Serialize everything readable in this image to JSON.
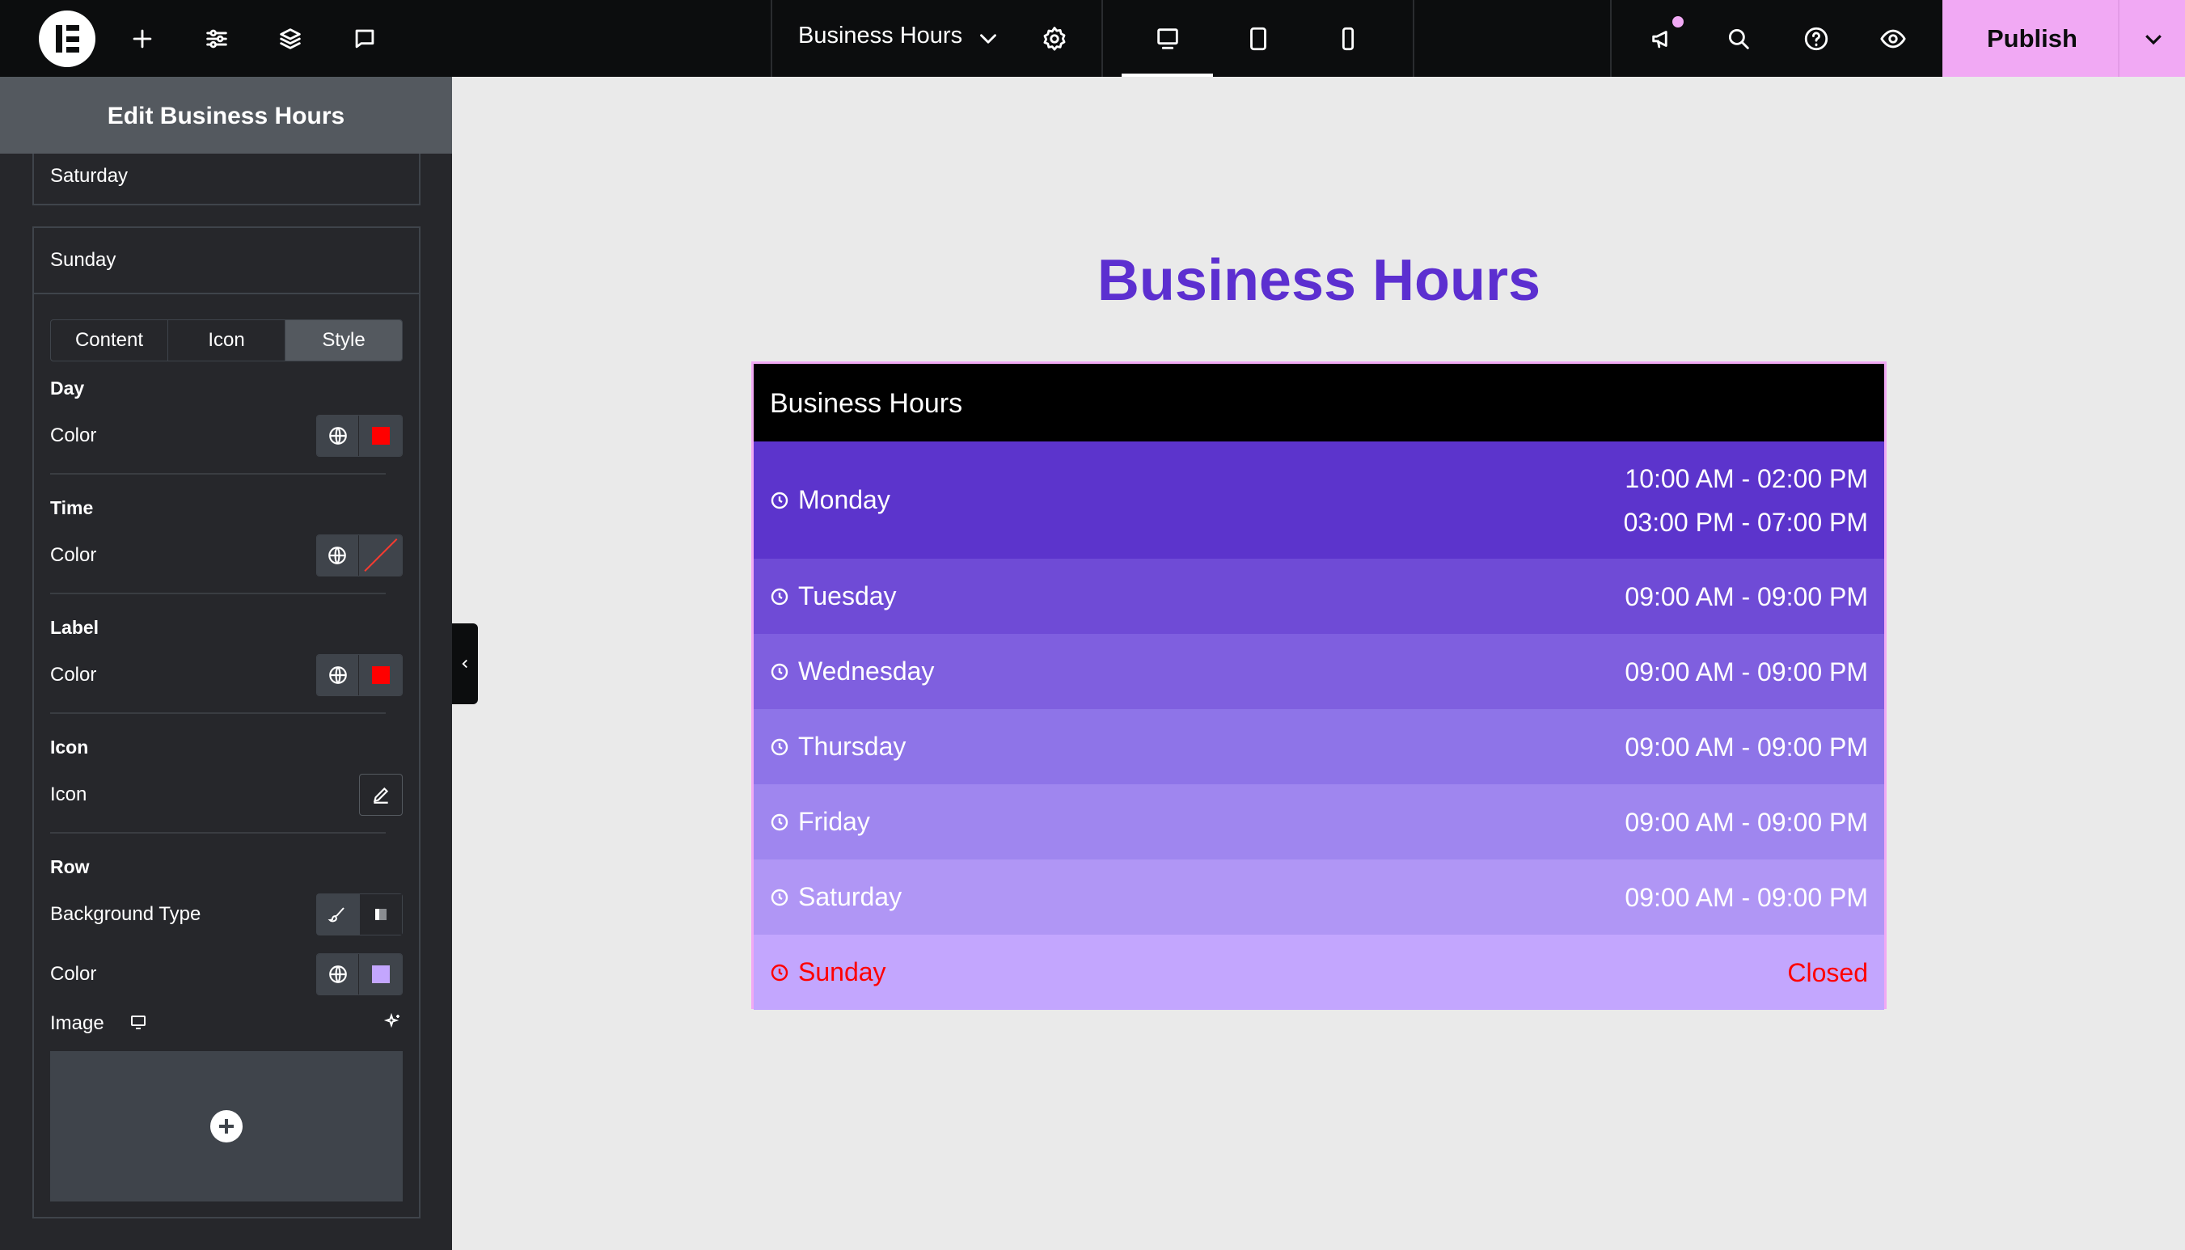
{
  "topbar": {
    "document_title": "Business Hours",
    "publish_label": "Publish",
    "colors": {
      "background": "#0c0d0e",
      "publish": "#f1a9f4",
      "notification_dot": "#f1a9f4"
    }
  },
  "panel": {
    "title": "Edit Business Hours",
    "repeater_items": [
      "Saturday",
      "Sunday"
    ],
    "tabs": [
      {
        "label": "Content",
        "active": false
      },
      {
        "label": "Icon",
        "active": false
      },
      {
        "label": "Style",
        "active": true
      }
    ],
    "sections": {
      "day": {
        "heading": "Day",
        "color_label": "Color",
        "swatch": "#ff0000"
      },
      "time": {
        "heading": "Time",
        "color_label": "Color",
        "swatch": "none"
      },
      "label": {
        "heading": "Label",
        "color_label": "Color",
        "swatch": "#ff0000"
      },
      "icon": {
        "heading": "Icon",
        "control_label": "Icon"
      },
      "row": {
        "heading": "Row",
        "bg_type_label": "Background Type",
        "color_label": "Color",
        "swatch": "#c3a6fe",
        "image_label": "Image"
      }
    }
  },
  "canvas": {
    "title": "Business Hours",
    "title_color": "#5c2fd0",
    "widget": {
      "header": "Business Hours",
      "highlight_color": "#ff0000",
      "rows": [
        {
          "day": "Monday",
          "times": [
            "10:00 AM - 02:00 PM",
            "03:00 PM - 07:00 PM"
          ],
          "background": "#5c34cc",
          "text_color": "#ffffff"
        },
        {
          "day": "Tuesday",
          "times": [
            "09:00 AM - 09:00 PM"
          ],
          "background": "#6f4bd6",
          "text_color": "#ffffff"
        },
        {
          "day": "Wednesday",
          "times": [
            "09:00 AM - 09:00 PM"
          ],
          "background": "#7f5fdf",
          "text_color": "#ffffff"
        },
        {
          "day": "Thursday",
          "times": [
            "09:00 AM - 09:00 PM"
          ],
          "background": "#8e74e8",
          "text_color": "#ffffff"
        },
        {
          "day": "Friday",
          "times": [
            "09:00 AM - 09:00 PM"
          ],
          "background": "#9f86ef",
          "text_color": "#ffffff"
        },
        {
          "day": "Saturday",
          "times": [
            "09:00 AM - 09:00 PM"
          ],
          "background": "#b096f5",
          "text_color": "#ffffff"
        },
        {
          "day": "Sunday",
          "times": [
            "Closed"
          ],
          "background": "#c3a6fe",
          "text_color": "#ff0000"
        }
      ]
    }
  }
}
